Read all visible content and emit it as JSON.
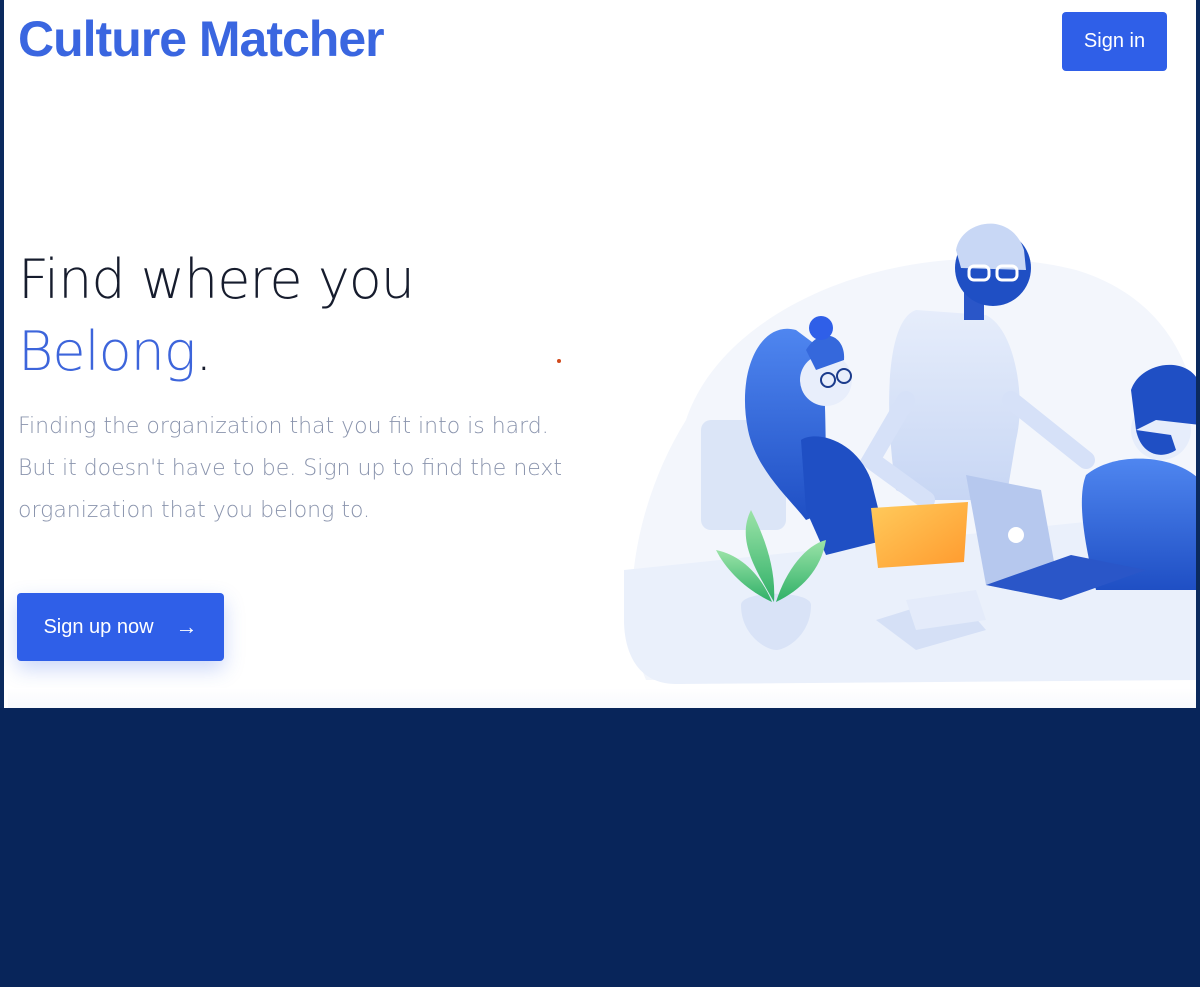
{
  "header": {
    "logo_text": "Culture Matcher",
    "signin_label": "Sign in"
  },
  "hero": {
    "headline_line1": "Find where you",
    "headline_accent": "Belong",
    "headline_period": ".",
    "lede": "Finding the organization that you fit into is hard. But it doesn't have to be. Sign up to find the next organization that you belong to.",
    "cta_label": "Sign up now",
    "cta_icon": "arrow-right-icon"
  },
  "colors": {
    "brand": "#3a66e0",
    "button": "#2f5fe8",
    "heading": "#161c2d",
    "muted": "#8a94ad",
    "backdrop": "#08255a"
  }
}
